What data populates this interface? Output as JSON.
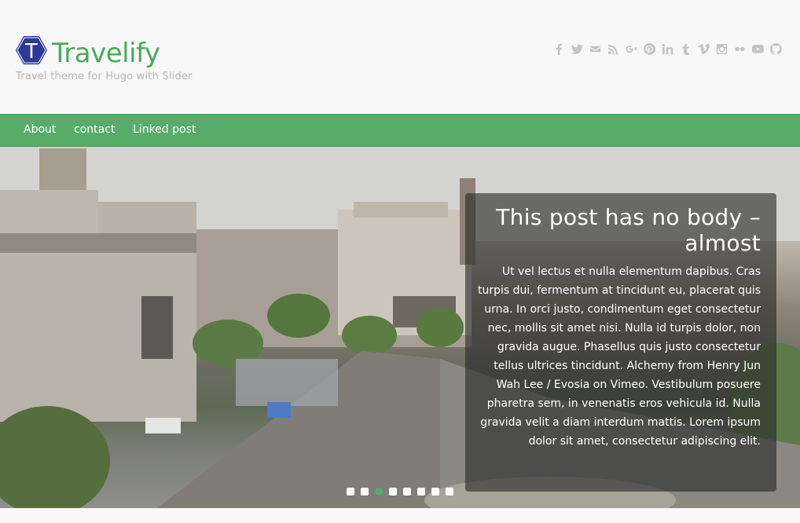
{
  "site": {
    "logo_letter": "T",
    "title": "Travelify",
    "tagline": "Travel theme for Hugo with Slider"
  },
  "social_icons": [
    "facebook-icon",
    "twitter-icon",
    "email-icon",
    "rss-icon",
    "google-plus-icon",
    "pinterest-icon",
    "linkedin-icon",
    "tumblr-icon",
    "vimeo-icon",
    "instagram-icon",
    "flickr-icon",
    "youtube-icon",
    "github-icon"
  ],
  "nav": {
    "items": [
      {
        "label": "About"
      },
      {
        "label": "contact"
      },
      {
        "label": "Linked post"
      }
    ]
  },
  "slider": {
    "slide_count": 8,
    "active_slide": 3,
    "title": "This post has no body – almost",
    "excerpt": "Ut vel lectus et nulla elementum dapibus. Cras turpis dui, fermentum at tincidunt eu, placerat quis urna. In orci justo, condimentum eget consectetur nec, mollis sit amet nisi. Nulla id turpis dolor, non gravida augue. Phasellus quis justo consectetur tellus ultrices tincidunt. Alchemy from Henry Jun Wah Lee / Evosia on Vimeo. Vestibulum posuere pharetra sem, in venenatis eros vehicula id. Nulla gravida velit a diam interdum mattis. Lorem ipsum dolor sit amet, consectetur adipiscing elit."
  },
  "colors": {
    "accent": "#57ad68",
    "logo_hex": "#2c3a96",
    "icon_gray": "#c4c4c4"
  }
}
